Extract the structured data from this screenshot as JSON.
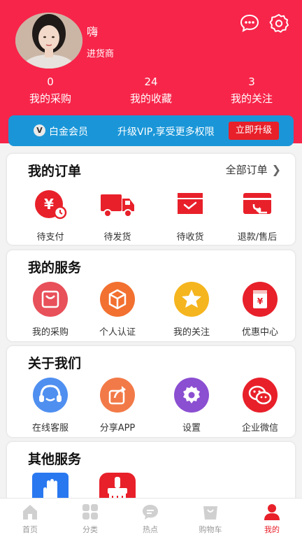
{
  "colors": {
    "brand": "#f7254a",
    "vip_bar": "#1a96d8",
    "accent_red": "#e8202a"
  },
  "user": {
    "name": "嗨",
    "role": "进货商"
  },
  "header_icons": [
    "message-icon",
    "settings-icon"
  ],
  "stats": [
    {
      "value": "0",
      "label": "我的采购"
    },
    {
      "value": "24",
      "label": "我的收藏"
    },
    {
      "value": "3",
      "label": "我的关注"
    }
  ],
  "vip": {
    "badge": "V",
    "title": "白金会员",
    "description": "升级VIP,享受更多权限",
    "button": "立即升级"
  },
  "orders": {
    "title": "我的订单",
    "all_link": "全部订单",
    "items": [
      {
        "label": "待支付",
        "icon": "wallet-clock-icon"
      },
      {
        "label": "待发货",
        "icon": "truck-icon"
      },
      {
        "label": "待收货",
        "icon": "inbox-icon"
      },
      {
        "label": "退款/售后",
        "icon": "refund-icon"
      }
    ]
  },
  "services": {
    "title": "我的服务",
    "items": [
      {
        "label": "我的采购",
        "icon": "shopping-bag-icon"
      },
      {
        "label": "个人认证",
        "icon": "cube-icon"
      },
      {
        "label": "我的关注",
        "icon": "star-icon"
      },
      {
        "label": "优惠中心",
        "icon": "coupon-icon"
      }
    ]
  },
  "about": {
    "title": "关于我们",
    "items": [
      {
        "label": "在线客服",
        "icon": "headset-icon"
      },
      {
        "label": "分享APP",
        "icon": "share-icon"
      },
      {
        "label": "设置",
        "icon": "gear-icon"
      },
      {
        "label": "企业微信",
        "icon": "wechat-icon"
      }
    ]
  },
  "other": {
    "title": "其他服务",
    "items": [
      {
        "label": "",
        "icon": "hand-icon"
      },
      {
        "label": "",
        "icon": "brush-icon"
      }
    ]
  },
  "tabs": [
    {
      "label": "首页",
      "icon": "home-icon",
      "active": false
    },
    {
      "label": "分类",
      "icon": "grid-icon",
      "active": false
    },
    {
      "label": "热点",
      "icon": "chat-icon",
      "active": false
    },
    {
      "label": "购物车",
      "icon": "cart-icon",
      "active": false
    },
    {
      "label": "我的",
      "icon": "user-icon",
      "active": true
    }
  ]
}
